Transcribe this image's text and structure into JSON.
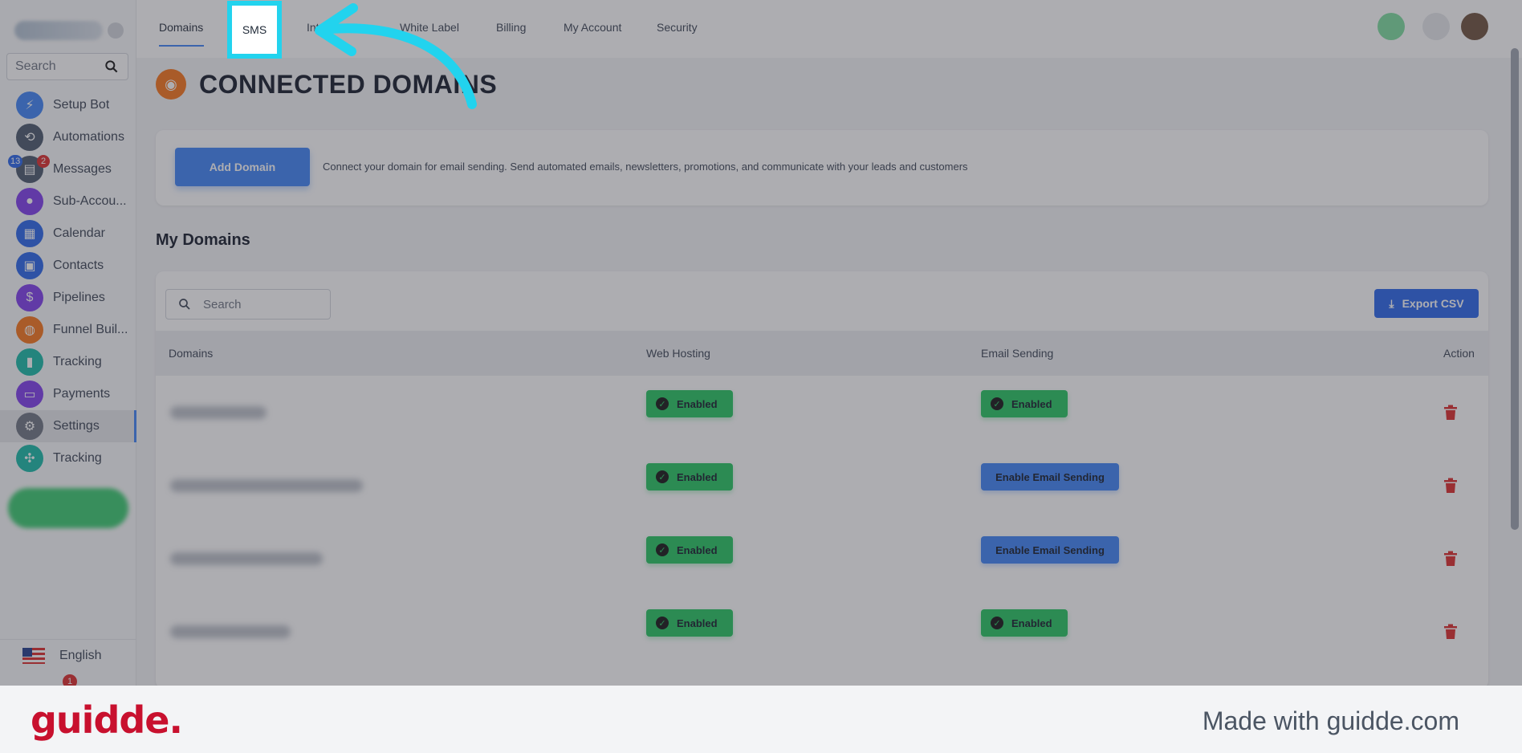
{
  "sidebar": {
    "search_placeholder": "Search",
    "items": [
      {
        "label": "Setup Bot",
        "icon": "bolt-icon",
        "color": "#3b82f6",
        "glyph": "⚡"
      },
      {
        "label": "Automations",
        "icon": "automation-icon",
        "color": "#475569",
        "glyph": "⟲"
      },
      {
        "label": "Messages",
        "icon": "chat-icon",
        "color": "#475569",
        "glyph": "▤",
        "badge_left": "13",
        "badge_right": "2"
      },
      {
        "label": "Sub-Accou...",
        "icon": "user-icon",
        "color": "#7c3aed",
        "glyph": "●"
      },
      {
        "label": "Calendar",
        "icon": "calendar-icon",
        "color": "#2563eb",
        "glyph": "▦"
      },
      {
        "label": "Contacts",
        "icon": "contacts-icon",
        "color": "#2563eb",
        "glyph": "▣"
      },
      {
        "label": "Pipelines",
        "icon": "dollar-icon",
        "color": "#7c3aed",
        "glyph": "$"
      },
      {
        "label": "Funnel Buil...",
        "icon": "funnel-icon",
        "color": "#f97316",
        "glyph": "◍"
      },
      {
        "label": "Tracking",
        "icon": "bar-chart-icon",
        "color": "#14b8a6",
        "glyph": "▮"
      },
      {
        "label": "Payments",
        "icon": "card-icon",
        "color": "#7c3aed",
        "glyph": "▭"
      },
      {
        "label": "Settings",
        "icon": "gear-icon",
        "color": "#6b7280",
        "glyph": "⚙"
      },
      {
        "label": "Tracking",
        "icon": "network-icon",
        "color": "#14b8a6",
        "glyph": "✣"
      }
    ],
    "language": "English",
    "bottom_badge": "1"
  },
  "topbar": {
    "tabs": [
      "Domains",
      "SMS",
      "Int",
      "White Label",
      "Billing",
      "My Account",
      "Security"
    ]
  },
  "main": {
    "page_title": "CONNECTED DOMAINS",
    "add_domain_label": "Add Domain",
    "description": "Connect your domain for email sending. Send automated emails, newsletters, promotions, and communicate with your leads and customers",
    "section_title": "My Domains",
    "table_search_placeholder": "Search",
    "export_label": "Export CSV",
    "columns": [
      "Domains",
      "Web Hosting",
      "Email Sending",
      "Action"
    ],
    "rows": [
      {
        "hosting": "Enabled",
        "email": "Enabled",
        "email_state": "enabled"
      },
      {
        "hosting": "Enabled",
        "email": "Enable Email Sending",
        "email_state": "button"
      },
      {
        "hosting": "Enabled",
        "email": "Enable Email Sending",
        "email_state": "button"
      },
      {
        "hosting": "Enabled",
        "email": "Enabled",
        "email_state": "enabled"
      }
    ]
  },
  "footer": {
    "logo": "guidde.",
    "made_with": "Made with guidde.com"
  },
  "colors": {
    "accent": "#3b82f6",
    "success": "#22c55e",
    "highlight": "#22d3ee",
    "brand": "#c8102e"
  }
}
